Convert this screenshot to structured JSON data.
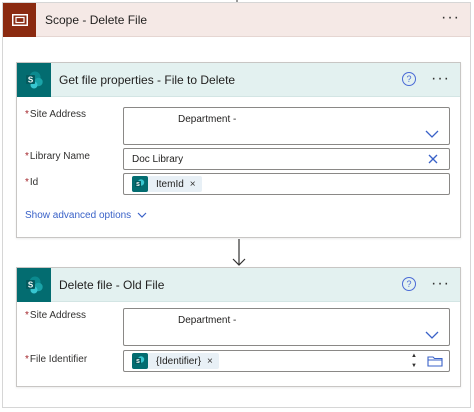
{
  "scope": {
    "title": "Scope - Delete File",
    "more": "···",
    "icon": "scope-icon",
    "color": "#8b2a10"
  },
  "card1": {
    "title": "Get file properties - File to Delete",
    "help": "?",
    "more": "···",
    "icon": "sharepoint-icon",
    "fields": {
      "site_address": {
        "label": "Site Address",
        "value": "Department -"
      },
      "library_name": {
        "label": "Library Name",
        "value": "Doc Library"
      },
      "id": {
        "label": "Id",
        "token": "ItemId",
        "token_x": "×"
      }
    },
    "advanced": "Show advanced options"
  },
  "card2": {
    "title": "Delete file - Old File",
    "help": "?",
    "more": "···",
    "icon": "sharepoint-icon",
    "fields": {
      "site_address": {
        "label": "Site Address",
        "value": "Department -"
      },
      "file_identifier": {
        "label": "File Identifier",
        "token": "{Identifier}",
        "token_x": "×"
      }
    }
  },
  "required_mark": "*",
  "spinner": {
    "up": "▲",
    "down": "▼"
  },
  "colors": {
    "sharepoint": "#036c70",
    "link": "#3a62c8",
    "required": "#a4262c"
  }
}
